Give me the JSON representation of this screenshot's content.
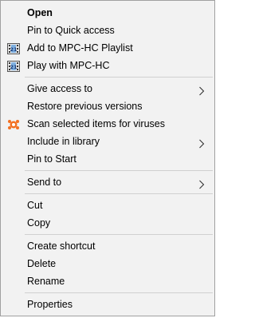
{
  "menu": {
    "open": "Open",
    "pin_quick_access": "Pin to Quick access",
    "add_mpc_playlist": "Add to MPC-HC Playlist",
    "play_mpc": "Play with MPC-HC",
    "give_access": "Give access to",
    "restore_versions": "Restore previous versions",
    "scan_viruses": "Scan selected items for viruses",
    "include_library": "Include in library",
    "pin_start": "Pin to Start",
    "send_to": "Send to",
    "cut": "Cut",
    "copy": "Copy",
    "create_shortcut": "Create shortcut",
    "delete": "Delete",
    "rename": "Rename",
    "properties": "Properties"
  },
  "icons": {
    "mpc": "mpc-hc-icon",
    "avast": "avast-icon",
    "submenu": "chevron-right-icon"
  },
  "colors": {
    "menu_bg": "#f2f2f2",
    "border": "#a0a0a0",
    "separator": "#d0d0d0",
    "avast_orange": "#f37021"
  }
}
